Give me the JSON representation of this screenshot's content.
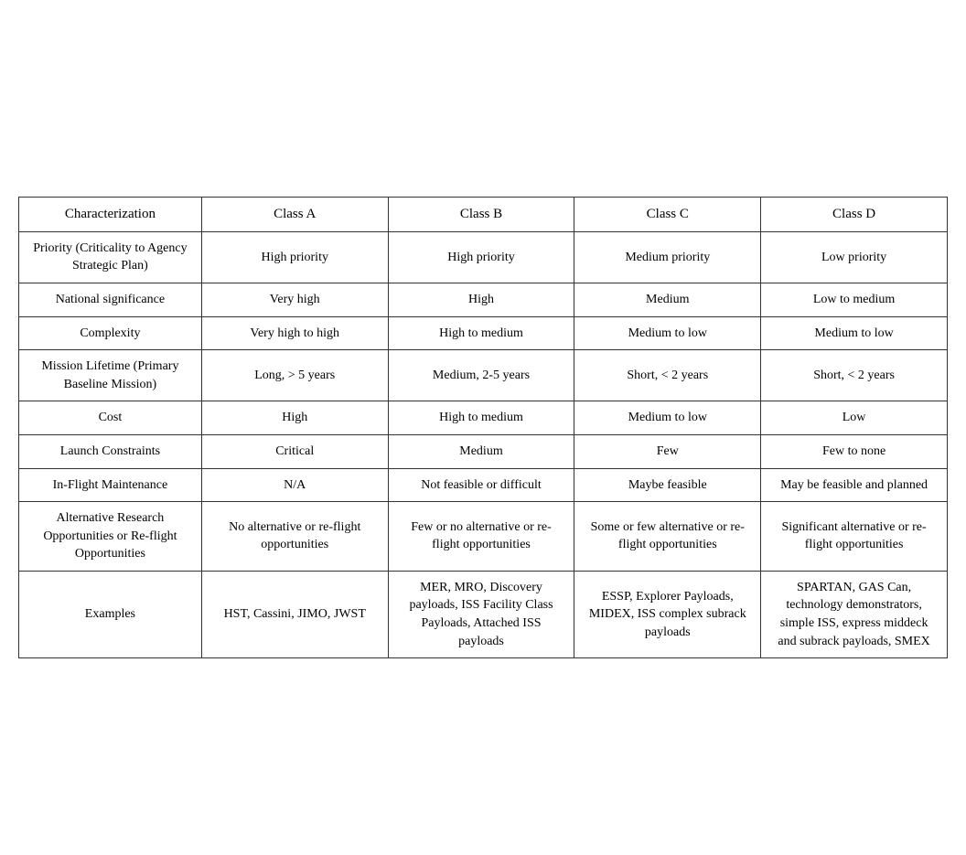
{
  "table": {
    "headers": [
      "Characterization",
      "Class A",
      "Class B",
      "Class C",
      "Class D"
    ],
    "rows": [
      {
        "char": "Priority (Criticality to Agency Strategic Plan)",
        "a": "High priority",
        "b": "High  priority",
        "c": "Medium priority",
        "d": "Low priority"
      },
      {
        "char": "National significance",
        "a": "Very high",
        "b": "High",
        "c": "Medium",
        "d": "Low to medium"
      },
      {
        "char": "Complexity",
        "a": "Very high to high",
        "b": "High to medium",
        "c": "Medium to low",
        "d": "Medium to low"
      },
      {
        "char": "Mission Lifetime (Primary Baseline Mission)",
        "a": "Long, > 5 years",
        "b": "Medium, 2-5 years",
        "c": "Short, < 2 years",
        "d": "Short, < 2 years"
      },
      {
        "char": "Cost",
        "a": "High",
        "b": "High to medium",
        "c": "Medium to low",
        "d": "Low"
      },
      {
        "char": "Launch Constraints",
        "a": "Critical",
        "b": "Medium",
        "c": "Few",
        "d": "Few to none"
      },
      {
        "char": "In-Flight Maintenance",
        "a": "N/A",
        "b": "Not feasible or difficult",
        "c": "Maybe feasible",
        "d": "May be feasible and planned"
      },
      {
        "char": "Alternative Research Opportunities or Re-flight Opportunities",
        "a": "No alternative or re-flight opportunities",
        "b": "Few or no alternative or re-flight opportunities",
        "c": "Some or few alternative or re-flight opportunities",
        "d": "Significant alternative or re-flight opportunities"
      },
      {
        "char": "Examples",
        "a": "HST, Cassini, JIMO, JWST",
        "b": "MER, MRO, Discovery payloads, ISS Facility Class Payloads, Attached ISS payloads",
        "c": "ESSP, Explorer Payloads, MIDEX, ISS complex subrack payloads",
        "d": "SPARTAN, GAS Can, technology demonstrators, simple ISS, express middeck and subrack payloads, SMEX"
      }
    ]
  }
}
